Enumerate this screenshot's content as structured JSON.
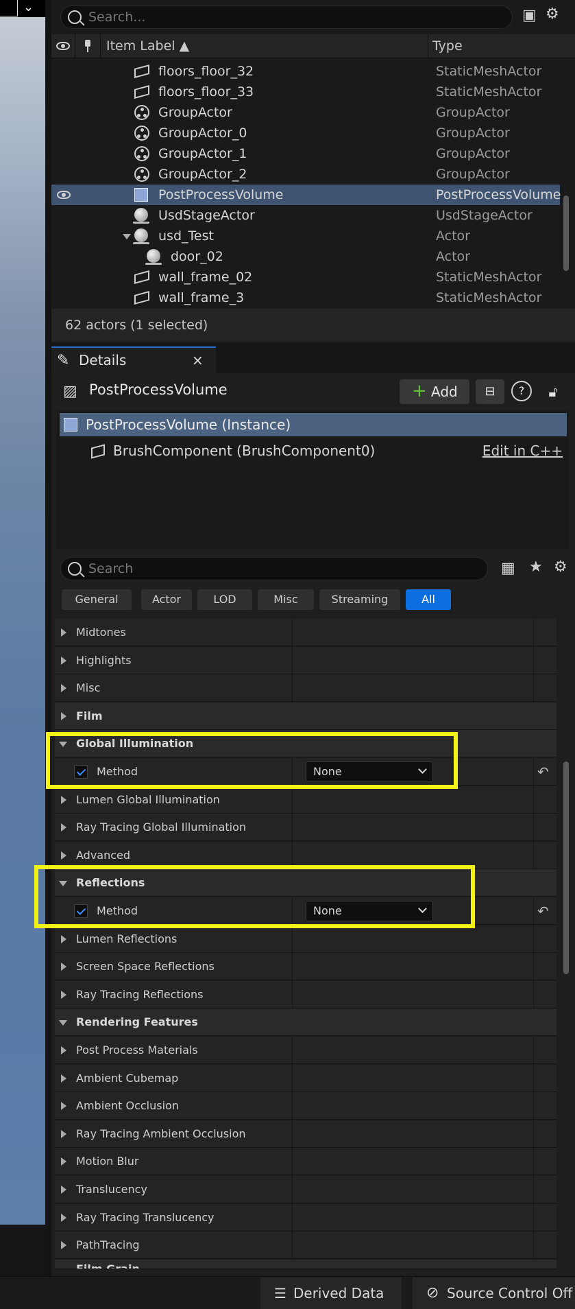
{
  "outliner": {
    "search_placeholder": "Search...",
    "col_label": "Item Label ▲",
    "col_type": "Type",
    "rows": [
      {
        "label": "floors_floor_32",
        "type": "StaticMeshActor"
      },
      {
        "label": "floors_floor_33",
        "type": "StaticMeshActor"
      },
      {
        "label": "GroupActor",
        "type": "GroupActor"
      },
      {
        "label": "GroupActor_0",
        "type": "GroupActor"
      },
      {
        "label": "GroupActor_1",
        "type": "GroupActor"
      },
      {
        "label": "GroupActor_2",
        "type": "GroupActor"
      },
      {
        "label": "PostProcessVolume",
        "type": "PostProcessVolume"
      },
      {
        "label": "UsdStageActor",
        "type": "UsdStageActor"
      },
      {
        "label": "usd_Test",
        "type": "Actor"
      },
      {
        "label": "door_02",
        "type": "Actor"
      },
      {
        "label": "wall_frame_02",
        "type": "StaticMeshActor"
      },
      {
        "label": "wall_frame_3",
        "type": "StaticMeshActor"
      }
    ],
    "status": "62 actors (1 selected)"
  },
  "details": {
    "tab_label": "Details",
    "actor_name": "PostProcessVolume",
    "add_label": "Add",
    "components": {
      "instance": "PostProcessVolume (Instance)",
      "brush": "BrushComponent (BrushComponent0)",
      "edit_cpp": "Edit in C++"
    },
    "search_placeholder": "Search",
    "filters": [
      "General",
      "Actor",
      "LOD",
      "Misc",
      "Streaming",
      "All"
    ],
    "properties": [
      {
        "label": "Midtones",
        "kind": "sub"
      },
      {
        "label": "Highlights",
        "kind": "sub"
      },
      {
        "label": "Misc",
        "kind": "sub"
      },
      {
        "label": "Film",
        "kind": "cat"
      },
      {
        "label": "Global Illumination",
        "kind": "cat-open"
      },
      {
        "label": "Method",
        "kind": "prop",
        "value": "None"
      },
      {
        "label": "Lumen Global Illumination",
        "kind": "sub"
      },
      {
        "label": "Ray Tracing Global Illumination",
        "kind": "sub"
      },
      {
        "label": "Advanced",
        "kind": "sub"
      },
      {
        "label": "Reflections",
        "kind": "cat-open"
      },
      {
        "label": "Method",
        "kind": "prop",
        "value": "None"
      },
      {
        "label": "Lumen Reflections",
        "kind": "sub"
      },
      {
        "label": "Screen Space Reflections",
        "kind": "sub"
      },
      {
        "label": "Ray Tracing Reflections",
        "kind": "sub"
      },
      {
        "label": "Rendering Features",
        "kind": "cat-open"
      },
      {
        "label": "Post Process Materials",
        "kind": "sub"
      },
      {
        "label": "Ambient Cubemap",
        "kind": "sub"
      },
      {
        "label": "Ambient Occlusion",
        "kind": "sub"
      },
      {
        "label": "Ray Tracing Ambient Occlusion",
        "kind": "sub"
      },
      {
        "label": "Motion Blur",
        "kind": "sub"
      },
      {
        "label": "Translucency",
        "kind": "sub"
      },
      {
        "label": "Ray Tracing Translucency",
        "kind": "sub"
      },
      {
        "label": "PathTracing",
        "kind": "sub"
      },
      {
        "label": "Film Grain",
        "kind": "cat-open"
      }
    ]
  },
  "statusbar": {
    "derived_data": "Derived Data",
    "source_control": "Source Control Off"
  },
  "colors": {
    "selection": "#3e5470",
    "accent": "#0d6ee0",
    "highlight": "#f2f218"
  }
}
